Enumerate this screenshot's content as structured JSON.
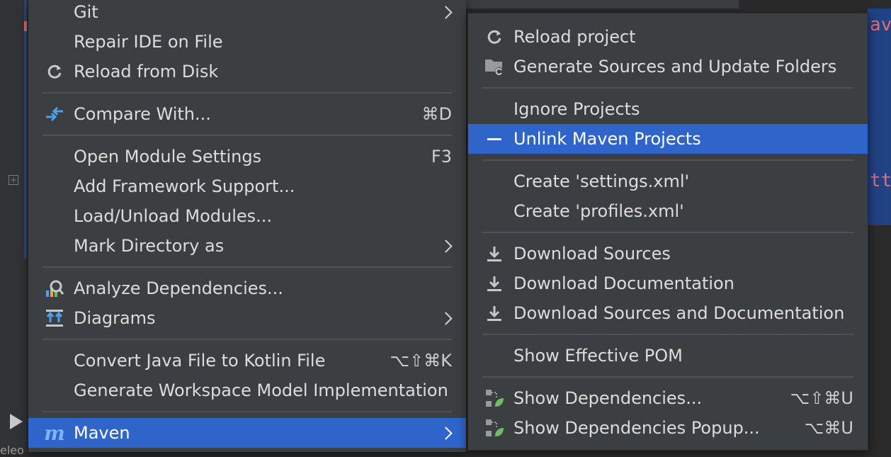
{
  "main_menu": {
    "items": [
      {
        "label": "Git",
        "shortcut": "",
        "icon": "",
        "has_submenu": true
      },
      {
        "label": "Repair IDE on File",
        "shortcut": "",
        "icon": ""
      },
      {
        "label": "Reload from Disk",
        "shortcut": "",
        "icon": "reload-icon"
      },
      {
        "label": "Compare With...",
        "shortcut": "⌘D",
        "icon": "compare-icon"
      },
      {
        "label": "Open Module Settings",
        "shortcut": "F3",
        "icon": ""
      },
      {
        "label": "Add Framework Support...",
        "shortcut": "",
        "icon": ""
      },
      {
        "label": "Load/Unload Modules...",
        "shortcut": "",
        "icon": ""
      },
      {
        "label": "Mark Directory as",
        "shortcut": "",
        "icon": "",
        "has_submenu": true
      },
      {
        "label": "Analyze Dependencies...",
        "shortcut": "",
        "icon": "analyze-icon"
      },
      {
        "label": "Diagrams",
        "shortcut": "",
        "icon": "diagram-icon",
        "has_submenu": true
      },
      {
        "label": "Convert Java File to Kotlin File",
        "shortcut": "⌥⇧⌘K",
        "icon": ""
      },
      {
        "label": "Generate Workspace Model Implementation",
        "shortcut": "",
        "icon": ""
      },
      {
        "label": "Maven",
        "shortcut": "",
        "icon": "maven-icon",
        "has_submenu": true,
        "selected": true
      }
    ]
  },
  "maven_submenu": {
    "items": [
      {
        "label": "Reload project",
        "icon": "reload-icon"
      },
      {
        "label": "Generate Sources and Update Folders",
        "icon": "folder-refresh-icon"
      },
      {
        "label": "Ignore Projects",
        "icon": ""
      },
      {
        "label": "Unlink Maven Projects",
        "icon": "minus-icon",
        "selected": true
      },
      {
        "label": "Create 'settings.xml'",
        "icon": ""
      },
      {
        "label": "Create 'profiles.xml'",
        "icon": ""
      },
      {
        "label": "Download Sources",
        "icon": "download-icon"
      },
      {
        "label": "Download Documentation",
        "icon": "download-icon"
      },
      {
        "label": "Download Sources and Documentation",
        "icon": "download-icon"
      },
      {
        "label": "Show Effective POM",
        "icon": ""
      },
      {
        "label": "Show Dependencies...",
        "icon": "dependencies-icon",
        "shortcut": "⌥⇧⌘U"
      },
      {
        "label": "Show Dependencies Popup...",
        "icon": "dependencies-icon",
        "shortcut": "⌥⌘U"
      }
    ]
  },
  "background": {
    "right_text_1": "av",
    "right_text_2": "tt",
    "bottom_text": "eleo"
  },
  "colors": {
    "menu_bg": "#3c3f41",
    "selection": "#2f65ca",
    "separator": "#515151",
    "text": "#dcdcdc"
  }
}
